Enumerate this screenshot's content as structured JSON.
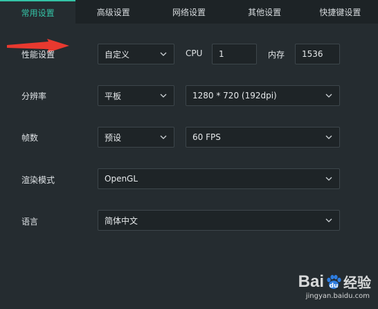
{
  "tabs": [
    "常用设置",
    "高级设置",
    "网络设置",
    "其他设置",
    "快捷键设置"
  ],
  "active_tab": 0,
  "accent_color": "#34c3a6",
  "performance": {
    "label": "性能设置",
    "mode_value": "自定义",
    "cpu_label": "CPU",
    "cpu_value": "1",
    "mem_label": "内存",
    "mem_value": "1536"
  },
  "resolution": {
    "label": "分辨率",
    "device_value": "平板",
    "size_value": "1280 * 720 (192dpi)"
  },
  "fps": {
    "label": "帧数",
    "preset_value": "预设",
    "fps_value": "60 FPS"
  },
  "render": {
    "label": "渲染模式",
    "value": "OpenGL"
  },
  "language": {
    "label": "语言",
    "value": "简体中文"
  },
  "watermark": {
    "brand_pre": "Bai",
    "brand_post": "经验",
    "url": "jingyan.baidu.com"
  }
}
